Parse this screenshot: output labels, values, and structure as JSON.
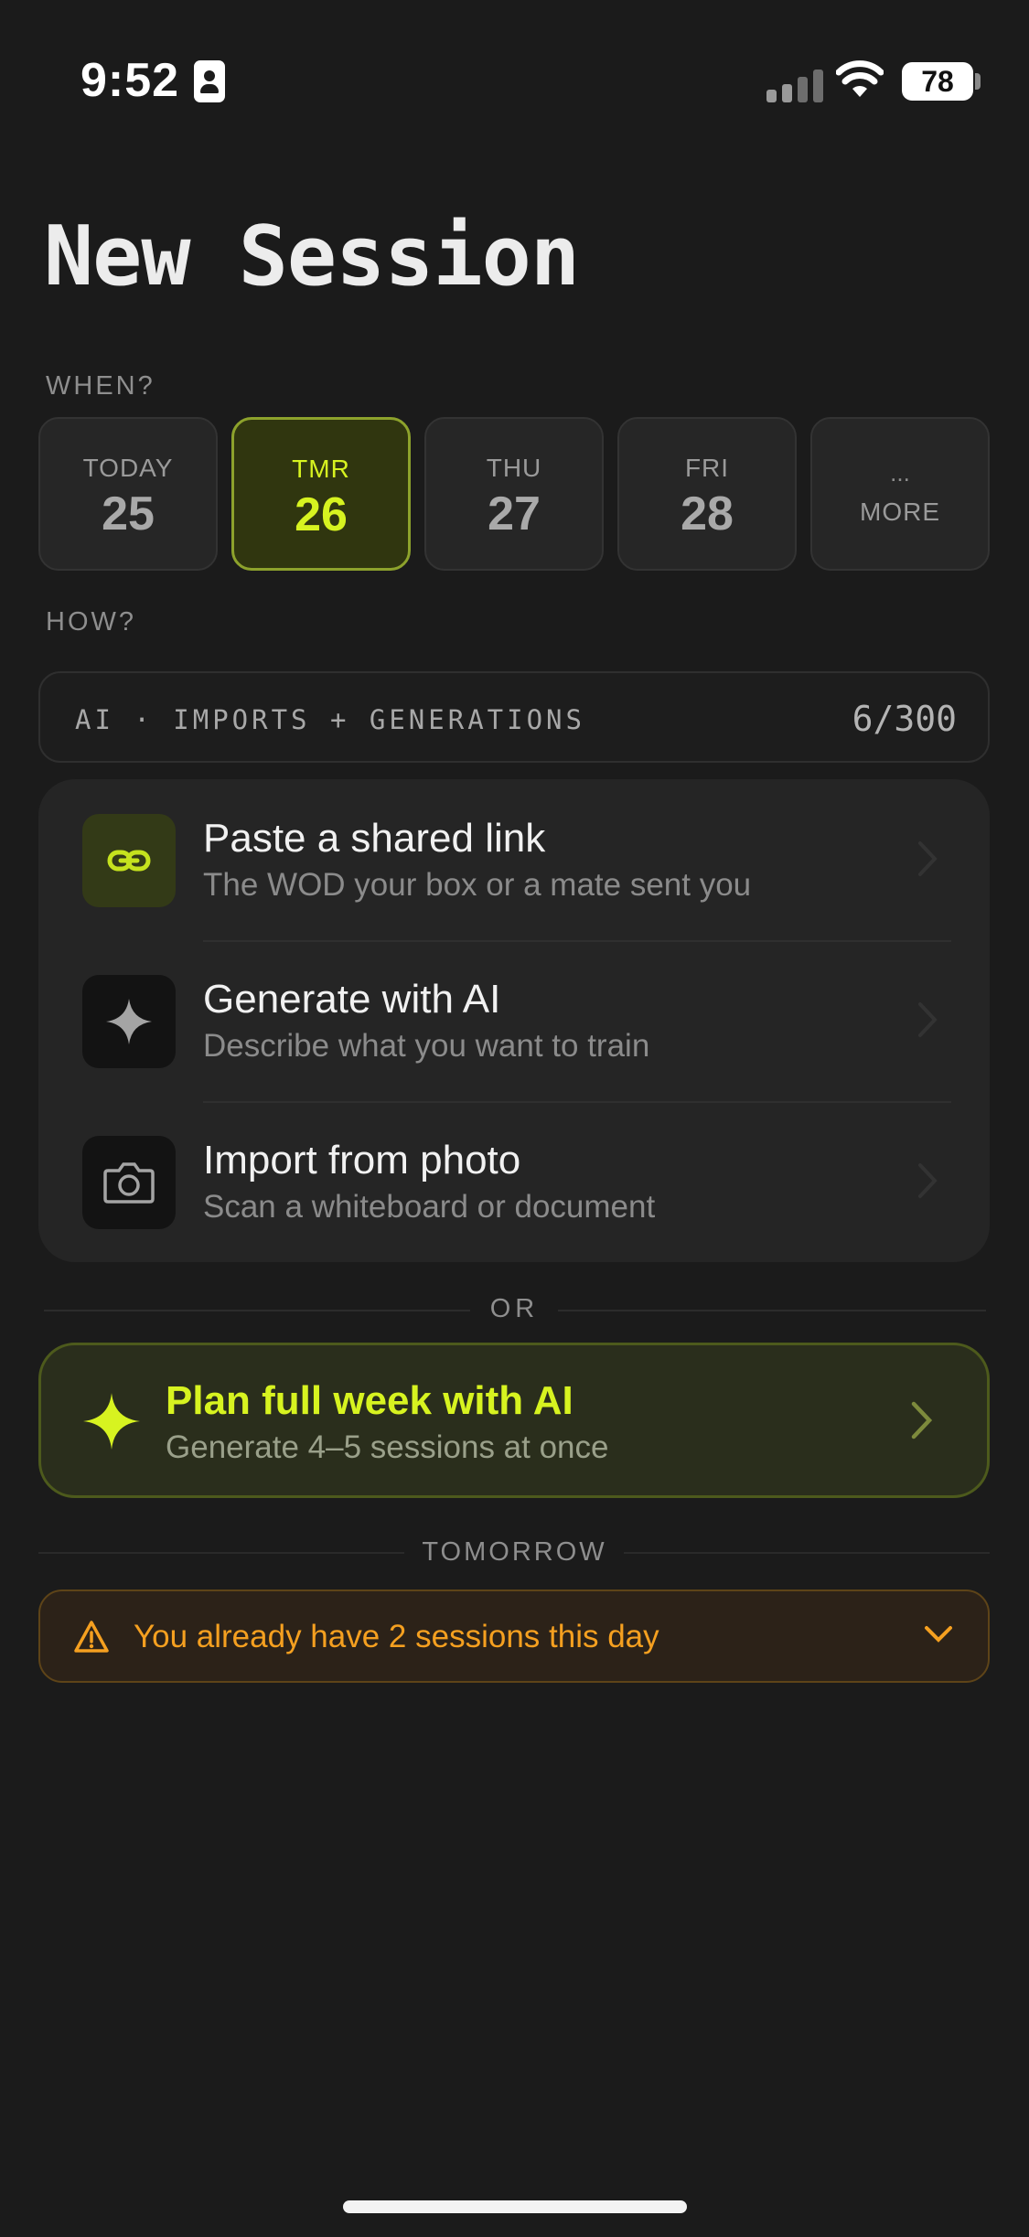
{
  "status_bar": {
    "time": "9:52",
    "battery": "78"
  },
  "title": "New Session",
  "when": {
    "label": "WHEN?",
    "days": [
      {
        "name": "TODAY",
        "number": "25",
        "selected": false
      },
      {
        "name": "TMR",
        "number": "26",
        "selected": true
      },
      {
        "name": "THU",
        "number": "27",
        "selected": false
      },
      {
        "name": "FRI",
        "number": "28",
        "selected": false
      }
    ],
    "more": {
      "dots": "...",
      "label": "MORE"
    }
  },
  "how": {
    "label": "HOW?"
  },
  "quota": {
    "label": "AI · IMPORTS + GENERATIONS",
    "count": "6/300"
  },
  "options": [
    {
      "title": "Paste a shared link",
      "subtitle": "The WOD your box or a mate sent you",
      "icon": "link-icon"
    },
    {
      "title": "Generate with AI",
      "subtitle": "Describe what you want to train",
      "icon": "sparkle-icon"
    },
    {
      "title": "Import from photo",
      "subtitle": "Scan a whiteboard or document",
      "icon": "camera-icon"
    }
  ],
  "separator": "OR",
  "plan": {
    "title": "Plan full week with AI",
    "subtitle": "Generate 4–5 sessions at once",
    "icon": "sparkle-icon"
  },
  "day_header": "TOMORROW",
  "warning": {
    "text": "You already have 2 sessions this day",
    "icon": "warning-icon"
  },
  "colors": {
    "accent": "#d7f320",
    "warning": "#f5a020",
    "background": "#1b1b1b"
  }
}
